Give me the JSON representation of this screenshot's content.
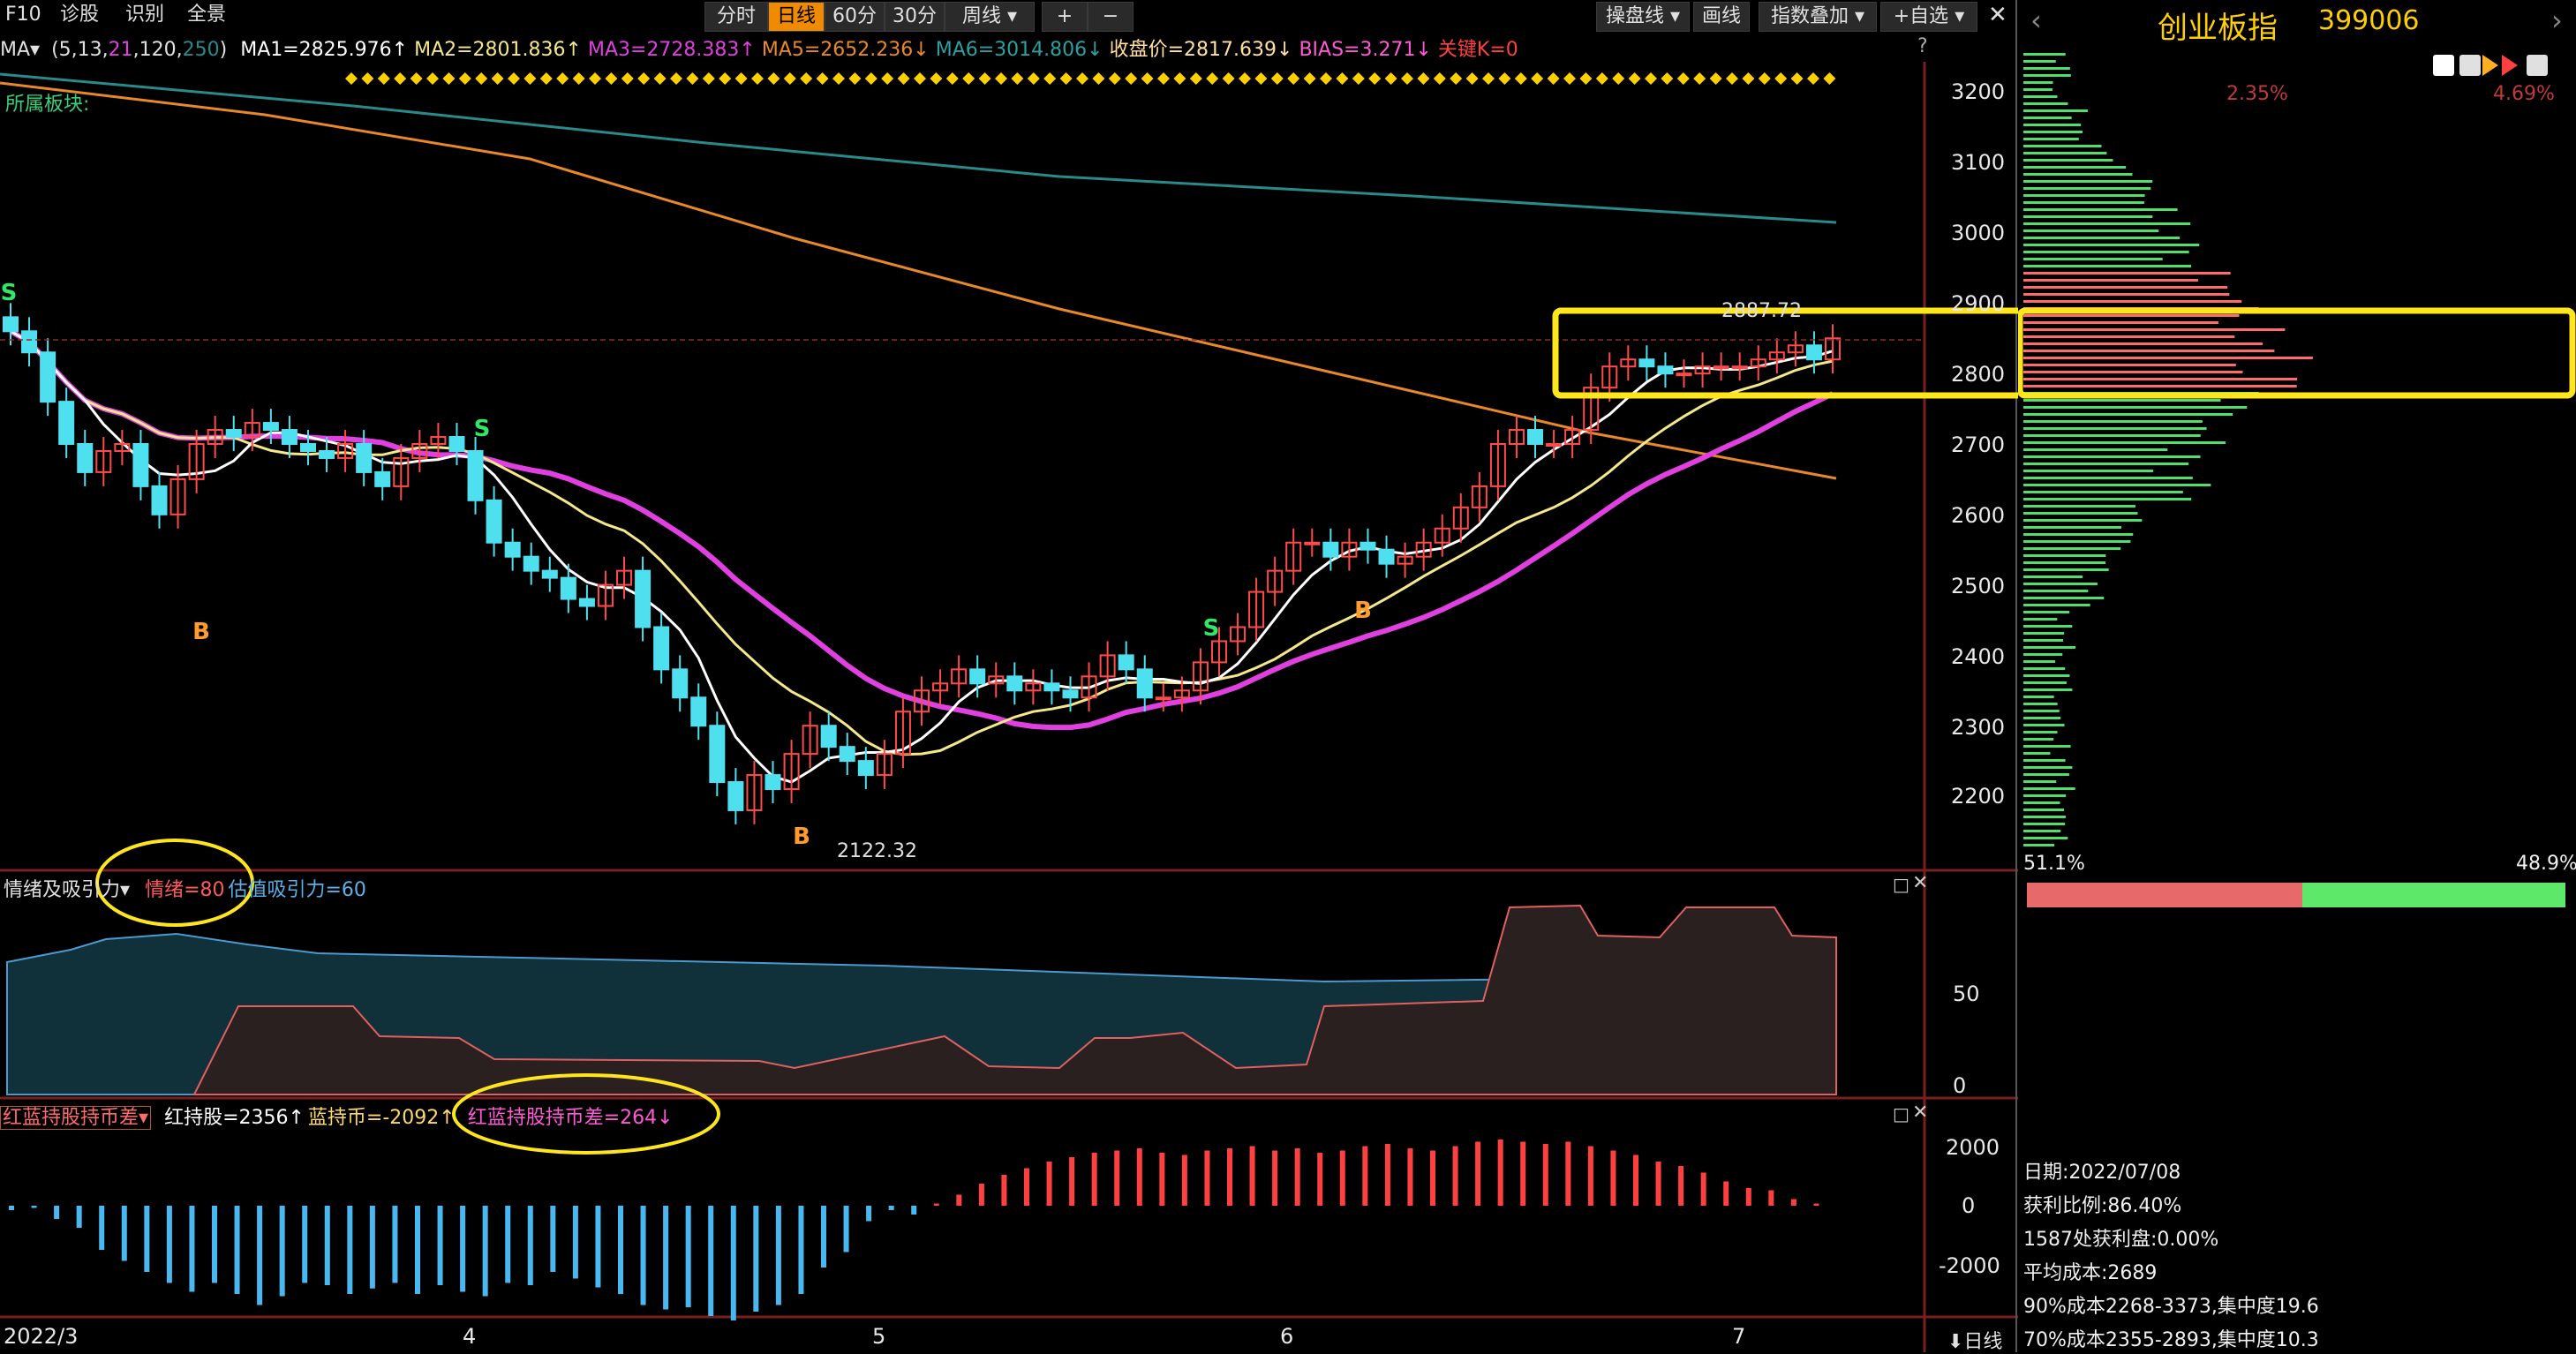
{
  "toolbar": {
    "left": [
      "F10",
      "诊股",
      "识别",
      "全景"
    ],
    "periods": [
      "分时",
      "日线",
      "60分",
      "30分",
      "周线"
    ],
    "active_period": "日线",
    "zoom": [
      "+",
      "−"
    ],
    "right": [
      "操盘线",
      "画线",
      "指数叠加",
      "+自选"
    ],
    "close": "✕"
  },
  "ma": {
    "label": "MA",
    "params_open": "(5,13,",
    "p21": "21",
    "p120": ",120,",
    "p250": "250",
    "params_close": ")",
    "ma1": "MA1=2825.976↑",
    "ma2": "MA2=2801.836↑",
    "ma3": "MA3=2728.383↑",
    "ma5": "MA5=2652.236↓",
    "ma6": "MA6=3014.806↓",
    "close": "收盘价=2817.639↓",
    "bias": "BIAS=3.271↓",
    "key": "关键K=0",
    "help": "?"
  },
  "sector_label": "所属板块:",
  "main_chart": {
    "y_ticks": [
      "3200",
      "3100",
      "3000",
      "2900",
      "2800",
      "2700",
      "2600",
      "2500",
      "2400",
      "2300",
      "2200"
    ],
    "low_label": "2122.32",
    "high_label": "2887.72",
    "markers": [
      {
        "text": "S",
        "color": "#2ee86a"
      },
      {
        "text": "B",
        "color": "#ff9b2f"
      },
      {
        "text": "S",
        "color": "#2ee86a"
      },
      {
        "text": "B",
        "color": "#ff9b2f"
      },
      {
        "text": "S",
        "color": "#2ee86a"
      },
      {
        "text": "B",
        "color": "#ff9b2f"
      }
    ]
  },
  "sub1": {
    "name": "情绪及吸引力",
    "v1": "情绪=80",
    "v2": "估值吸引力=60",
    "y_ticks": [
      "50",
      "0"
    ]
  },
  "sub2": {
    "name": "红蓝持股持币差",
    "v1": "红持股=2356↑",
    "v2": "蓝持币=-2092↑",
    "v3": "红蓝持股持币差=264↓",
    "y_ticks": [
      "2000",
      "0",
      "-2000"
    ]
  },
  "x_axis": {
    "labels": [
      "2022/3",
      "4",
      "5",
      "6",
      "7"
    ],
    "period_btn": "⬇日线"
  },
  "right_panel": {
    "title": "创业板指",
    "code": "399006",
    "pct_left": "2.35%",
    "pct_right": "4.69%",
    "ratio_left": "51.1%",
    "ratio_right": "48.9%",
    "info": [
      "日期:2022/07/08",
      "获利比例:86.40%",
      "1587处获利盘:0.00%",
      "平均成本:2689",
      "90%成本2268-3373,集中度19.6",
      "70%成本2355-2893,集中度10.3"
    ]
  },
  "colors": {
    "up": "#ff4a4a",
    "down": "#4fe0f0",
    "ma1": "#ffffff",
    "ma2": "#f5e88a",
    "ma3": "#e040e0",
    "ma5": "#e8882a",
    "ma6": "#2a8a8a",
    "highlight": "#ffe61c"
  }
}
